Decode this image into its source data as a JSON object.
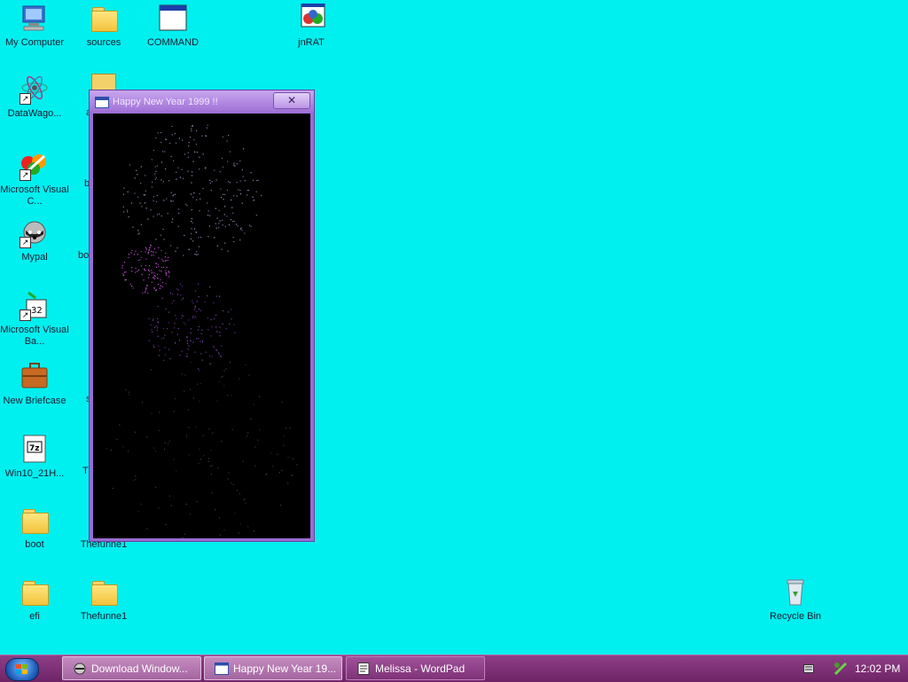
{
  "desktop": {
    "background": "#00f0f0",
    "icons": [
      {
        "label": "My Computer",
        "icon": "computer-icon"
      },
      {
        "label": "sources",
        "icon": "folder-icon"
      },
      {
        "label": "COMMAND",
        "icon": "window-icon"
      },
      {
        "label": "jnRAT",
        "icon": "app-icon"
      },
      {
        "label": "DataWago...",
        "icon": "atom-shortcut-icon"
      },
      {
        "label": "Microsoft Visual C...",
        "icon": "visual-c-shortcut-icon"
      },
      {
        "label": "Mypal",
        "icon": "raccoon-shortcut-icon"
      },
      {
        "label": "Microsoft Visual Ba...",
        "icon": "visual-basic-shortcut-icon"
      },
      {
        "label": "New Briefcase",
        "icon": "briefcase-icon"
      },
      {
        "label": "Win10_21H...",
        "icon": "7z-file-icon"
      },
      {
        "label": "boot",
        "icon": "folder-icon"
      },
      {
        "label": "efi",
        "icon": "folder-icon"
      },
      {
        "label": "Thefunne1",
        "icon": "folder-icon"
      },
      {
        "label": "Thefunne1",
        "icon": "folder-icon"
      },
      {
        "label": "Recycle Bin",
        "icon": "recycle-bin-icon"
      }
    ],
    "partial_labels": [
      "a",
      "b",
      "bo",
      "s",
      "T"
    ]
  },
  "window": {
    "title": "Happy New Year 1999 !!",
    "close_label": "✕",
    "accent": "#9c6dd4"
  },
  "taskbar": {
    "color": "#7a2c72",
    "buttons": [
      {
        "label": "Download Window...",
        "icon": "raccoon-icon"
      },
      {
        "label": "Happy New Year 19...",
        "icon": "window-icon"
      },
      {
        "label": "Melissa - WordPad",
        "icon": "wordpad-icon"
      }
    ],
    "clock": "12:02 PM"
  }
}
